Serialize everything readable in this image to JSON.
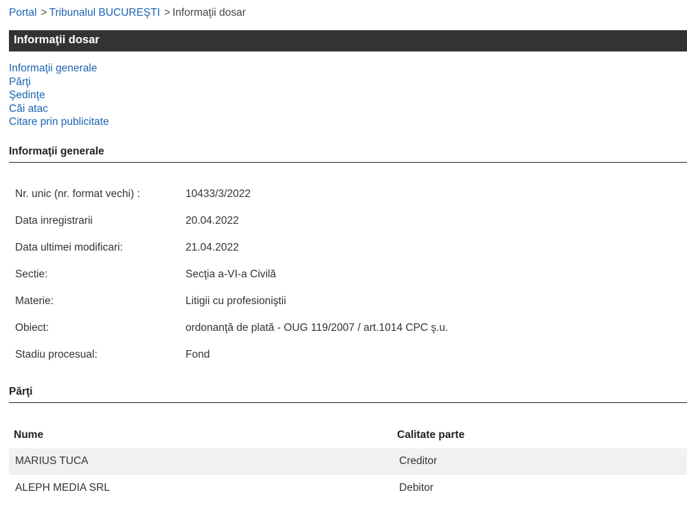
{
  "breadcrumb": {
    "items": [
      "Portal",
      "Tribunalul BUCUREŞTI"
    ],
    "current": "Informaţii dosar",
    "separator": ">"
  },
  "title": "Informaţii dosar",
  "toc": [
    "Informaţii generale",
    "Părţi",
    "Şedinţe",
    "Căi atac",
    "Citare prin publicitate"
  ],
  "general": {
    "heading": "Informaţii generale",
    "rows": [
      {
        "label": "Nr. unic (nr. format vechi) :",
        "value": "10433/3/2022"
      },
      {
        "label": "Data inregistrarii",
        "value": "20.04.2022"
      },
      {
        "label": "Data ultimei modificari:",
        "value": "21.04.2022"
      },
      {
        "label": "Sectie:",
        "value": "Secţia a-VI-a Civilă"
      },
      {
        "label": "Materie:",
        "value": "Litigii cu profesioniştii"
      },
      {
        "label": "Obiect:",
        "value": "ordonanţă de plată - OUG 119/2007 / art.1014 CPC ş.u."
      },
      {
        "label": "Stadiu procesual:",
        "value": "Fond"
      }
    ]
  },
  "parti": {
    "heading": "Părţi",
    "columns": [
      "Nume",
      "Calitate parte"
    ],
    "rows": [
      {
        "name": "MARIUS TUCA",
        "role": "Creditor"
      },
      {
        "name": "ALEPH MEDIA SRL",
        "role": "Debitor"
      }
    ]
  },
  "colors": {
    "link": "#1a63b3",
    "titlebar": "#333333",
    "row_alt": "#f1f1f1"
  }
}
